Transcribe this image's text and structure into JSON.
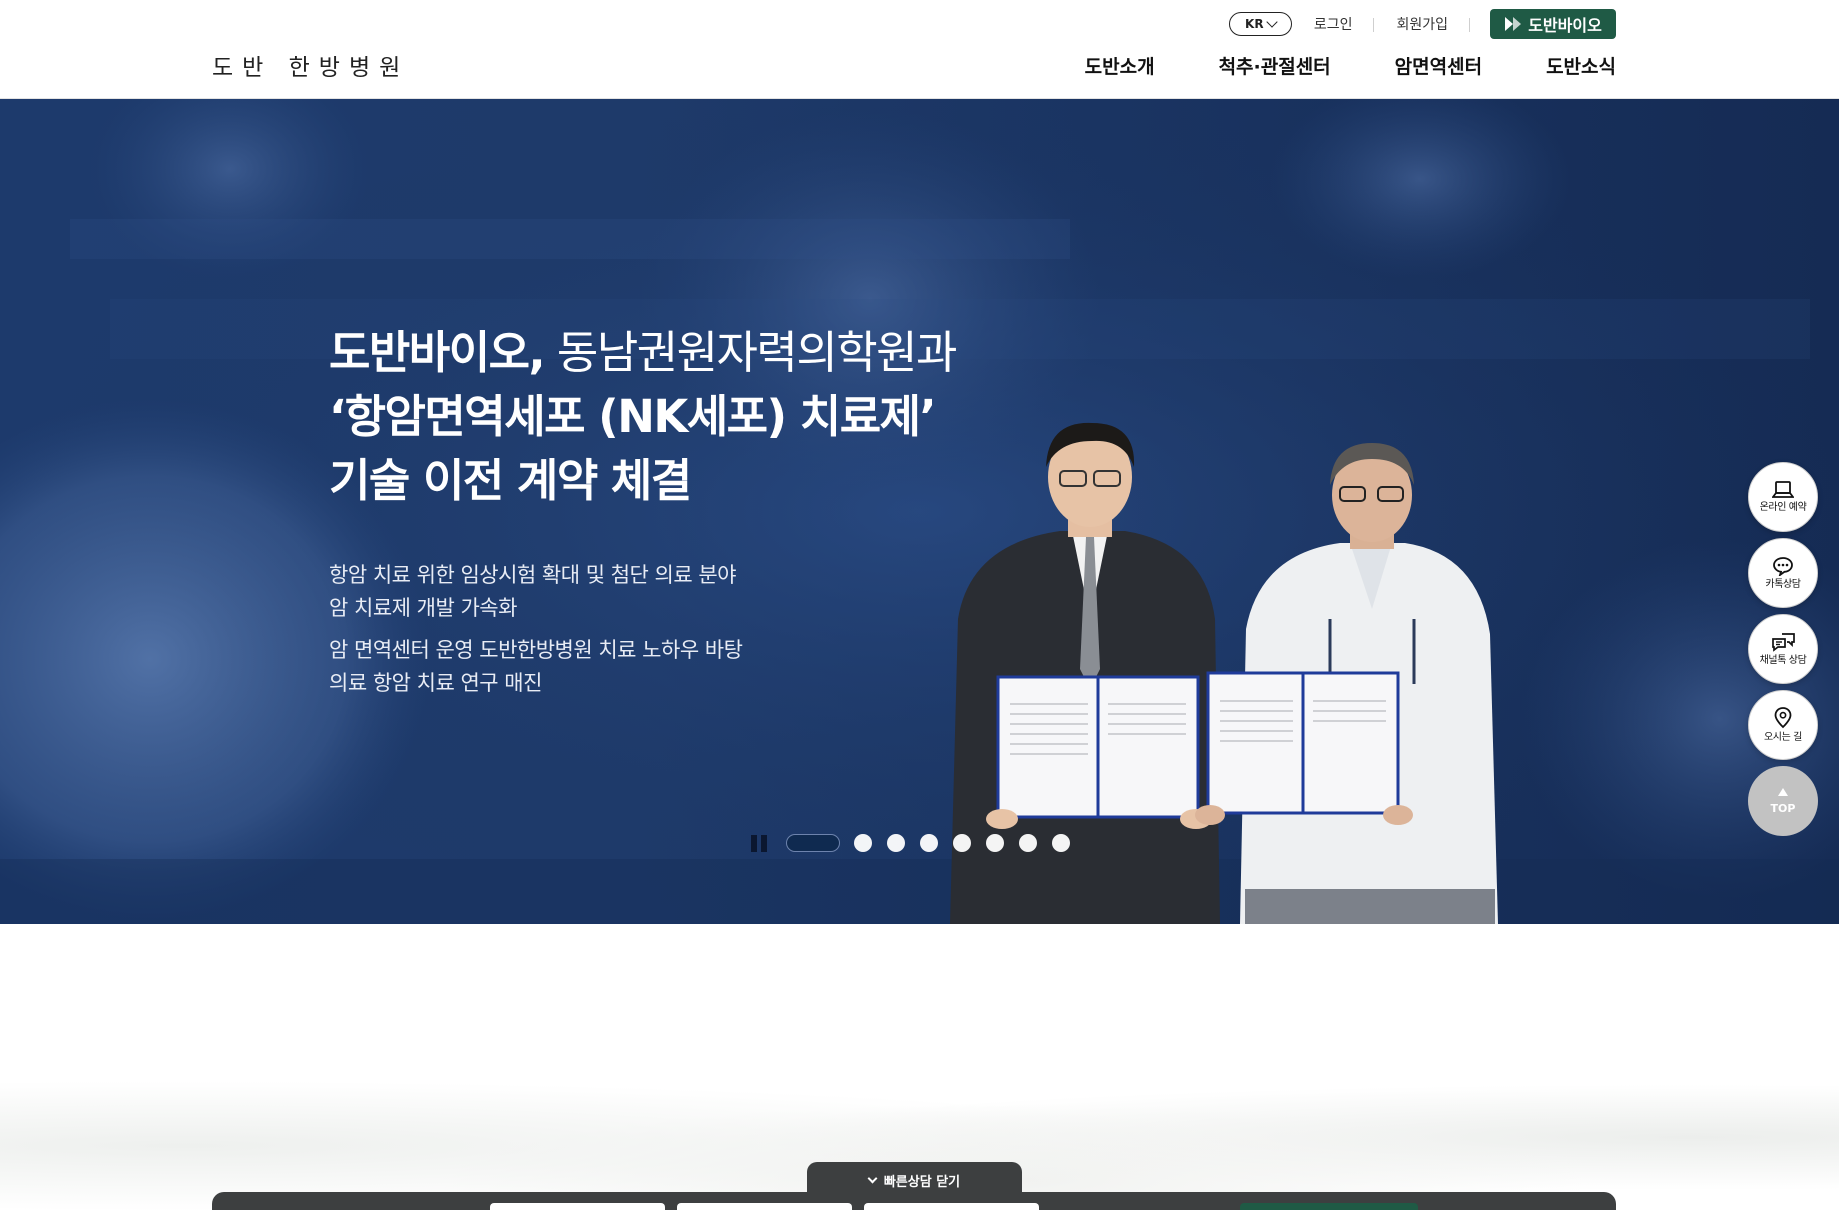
{
  "header": {
    "logo": "도반 한방병원",
    "lang": "KR",
    "login": "로그인",
    "signup": "회원가입",
    "bio_button": "도반바이오",
    "nav": [
      "도반소개",
      "척추·관절센터",
      "암면역센터",
      "도반소식"
    ]
  },
  "hero": {
    "title_bold_1": "도반바이오,",
    "title_thin_1": " 동남권원자력의학원과",
    "title_2": "‘항암면역세포 (NK세포) 치료제’",
    "title_3": "기술 이전 계약 체결",
    "sub_1a": "항암 치료 위한 임상시험 확대 및 첨단 의료 분야",
    "sub_1b": "암 치료제 개발 가속화",
    "sub_2a": "암 면역센터 운영 도반한방병원 치료 노하우 바탕",
    "sub_2b": "의료 항암 치료 연구 매진"
  },
  "slider": {
    "total": 8,
    "active": 1
  },
  "quick_menu": {
    "online": "온라인 예약",
    "kakao": "카톡상담",
    "channel": "채널톡 상담",
    "directions": "오시는 길",
    "top": "TOP"
  },
  "quick_consult": {
    "toggle": "빠른상담 닫기"
  },
  "colors": {
    "brand_green": "#1f5a45",
    "hero_blue": "#1e3a6a",
    "dark_bar": "#3d3f40"
  }
}
